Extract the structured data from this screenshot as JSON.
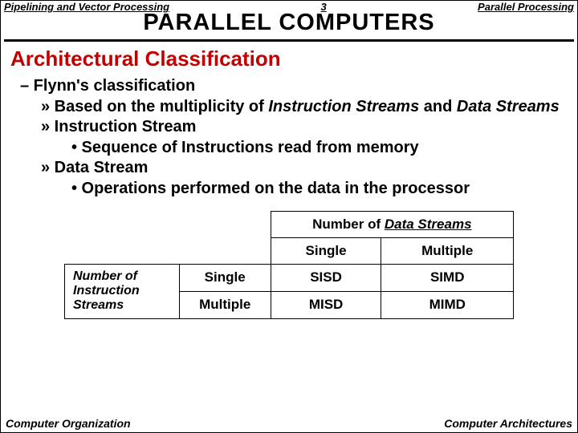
{
  "header": {
    "left": "Pipelining and Vector Processing",
    "center": "3",
    "right": "Parallel Processing"
  },
  "title": "PARALLEL  COMPUTERS",
  "section": "Architectural Classification",
  "bullets": {
    "b1": "–  Flynn's classification",
    "b2a": "» Based on the multiplicity of ",
    "b2b": "Instruction Streams",
    "b2c": " and ",
    "b2d": "Data Streams",
    "b3": "» Instruction Stream",
    "b4": "•  Sequence of Instructions read from memory",
    "b5": "» Data Stream",
    "b6": "•  Operations performed on the data in the processor"
  },
  "table": {
    "ds_label_a": "Number of ",
    "ds_label_b": "Data Streams",
    "col_single": "Single",
    "col_multiple": "Multiple",
    "row_label_a": "Number of",
    "row_label_b": "Instruction",
    "row_label_c": "Streams",
    "row_single": "Single",
    "row_multiple": "Multiple",
    "c11": "SISD",
    "c12": "SIMD",
    "c21": "MISD",
    "c22": "MIMD"
  },
  "footer": {
    "left": "Computer Organization",
    "right": "Computer Architectures"
  }
}
